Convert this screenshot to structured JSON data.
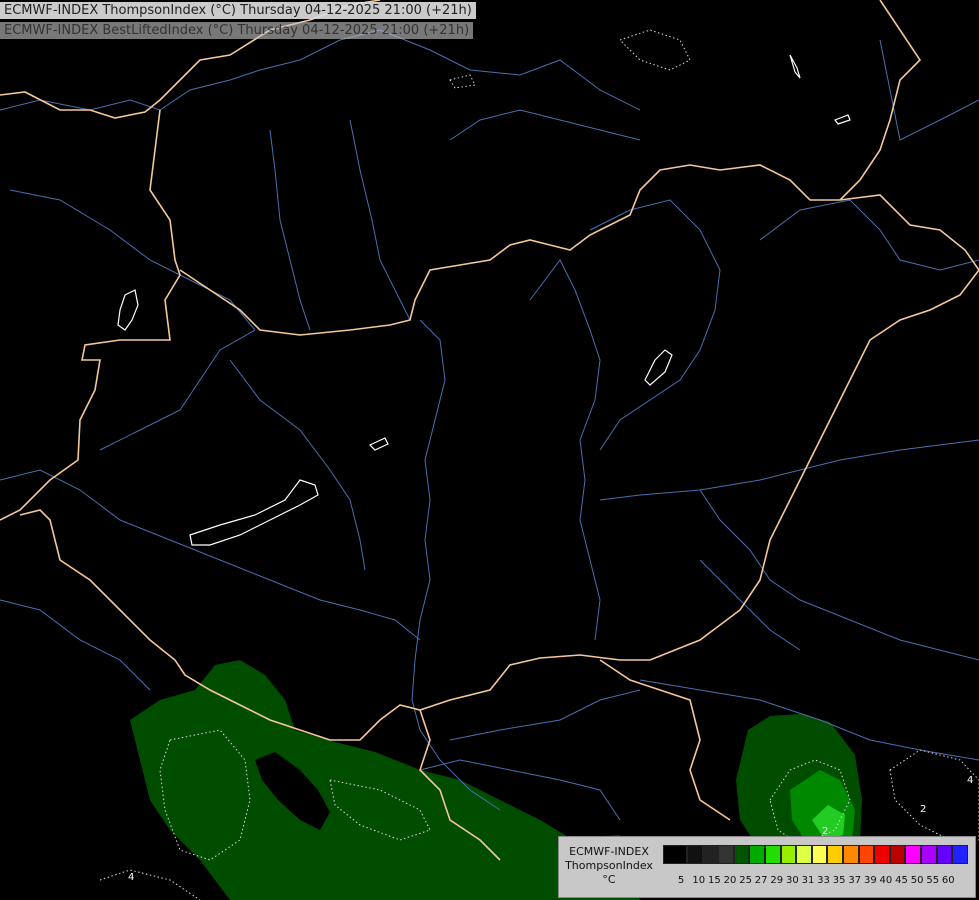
{
  "header": {
    "line1": "ECMWF-INDEX ThompsonIndex (°C) Thursday 04-12-2025 21:00 (+21h)",
    "line2": "ECMWF-INDEX BestLiftedIndex (°C) Thursday 04-12-2025 21:00 (+21h)"
  },
  "legend": {
    "line1": "ECMWF-INDEX",
    "line2": "ThompsonIndex",
    "unit": "°C",
    "ticks": [
      "5",
      "10",
      "15",
      "20",
      "25",
      "27",
      "29",
      "30",
      "31",
      "33",
      "35",
      "37",
      "39",
      "40",
      "45",
      "50",
      "55",
      "60"
    ],
    "colors": [
      "#000000",
      "#111111",
      "#222222",
      "#333333",
      "#005500",
      "#00aa00",
      "#22dd00",
      "#99ee00",
      "#ddff44",
      "#ffff55",
      "#ffcc00",
      "#ff8800",
      "#ff4400",
      "#ee0000",
      "#bb0000",
      "#ff00ff",
      "#aa00ff",
      "#6600ff",
      "#2222ff"
    ]
  },
  "contour_labels": [
    "4",
    "4",
    "2",
    "2"
  ],
  "colors": {
    "background": "#000000",
    "border": "#f5c89a",
    "river": "#4a6fb0",
    "lake": "#ffffff",
    "field_dark": "#004d00",
    "field_mid": "#008800",
    "field_light": "#22cc22",
    "contour": "#dddddd"
  }
}
